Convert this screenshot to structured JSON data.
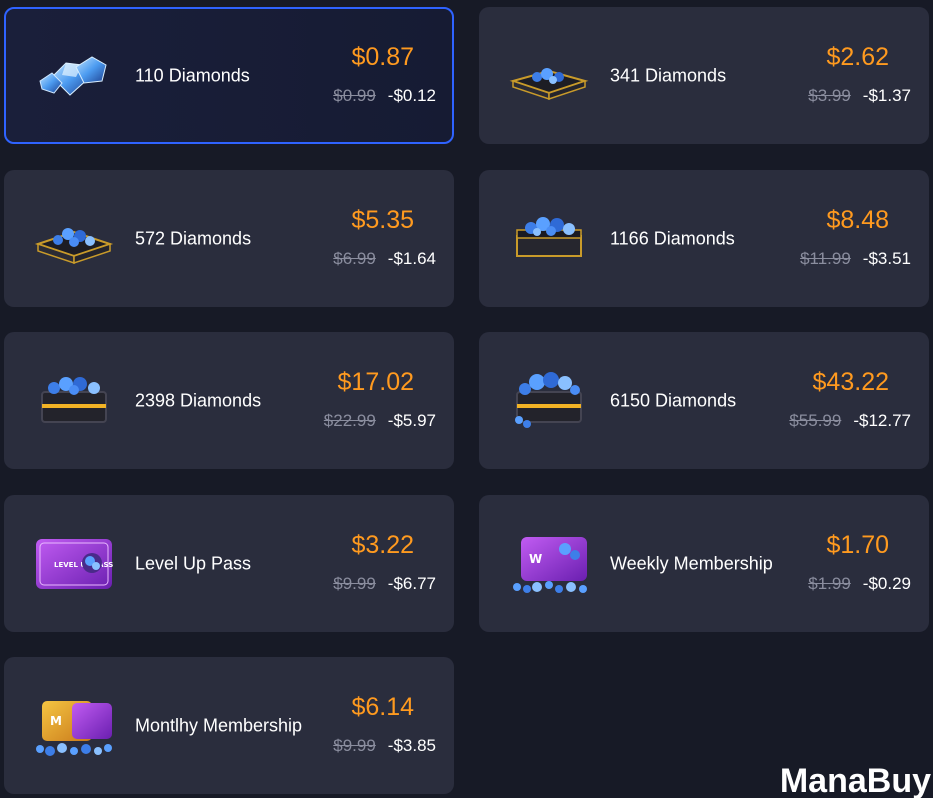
{
  "products": [
    {
      "name": "110 Diamonds",
      "price": "$0.87",
      "old_price": "$0.99",
      "discount": "-$0.12",
      "selected": true,
      "icon": "diamond-gem-icon"
    },
    {
      "name": "341 Diamonds",
      "price": "$2.62",
      "old_price": "$3.99",
      "discount": "-$1.37",
      "selected": false,
      "icon": "diamond-case-icon"
    },
    {
      "name": "572 Diamonds",
      "price": "$5.35",
      "old_price": "$6.99",
      "discount": "-$1.64",
      "selected": false,
      "icon": "diamond-case-icon"
    },
    {
      "name": "1166 Diamonds",
      "price": "$8.48",
      "old_price": "$11.99",
      "discount": "-$3.51",
      "selected": false,
      "icon": "diamond-case-icon"
    },
    {
      "name": "2398 Diamonds",
      "price": "$17.02",
      "old_price": "$22.99",
      "discount": "-$5.97",
      "selected": false,
      "icon": "diamond-chest-icon"
    },
    {
      "name": "6150 Diamonds",
      "price": "$43.22",
      "old_price": "$55.99",
      "discount": "-$12.77",
      "selected": false,
      "icon": "diamond-chest-icon"
    },
    {
      "name": "Level Up Pass",
      "price": "$3.22",
      "old_price": "$9.99",
      "discount": "-$6.77",
      "selected": false,
      "icon": "level-up-pass-icon",
      "badge_text": "LEVEL UP PASS"
    },
    {
      "name": "Weekly Membership",
      "price": "$1.70",
      "old_price": "$1.99",
      "discount": "-$0.29",
      "selected": false,
      "icon": "weekly-membership-icon",
      "badge_text": "W"
    },
    {
      "name": "Montlhy Membership",
      "price": "$6.14",
      "old_price": "$9.99",
      "discount": "-$3.85",
      "selected": false,
      "icon": "monthly-membership-icon",
      "badge_text": "M"
    }
  ],
  "brand": {
    "logo_text": "ManaBuy"
  },
  "colors": {
    "accent": "#ff9a1f",
    "selected_border": "#2f63ff",
    "card_bg": "#2a2d3d",
    "page_bg": "#171a26"
  }
}
